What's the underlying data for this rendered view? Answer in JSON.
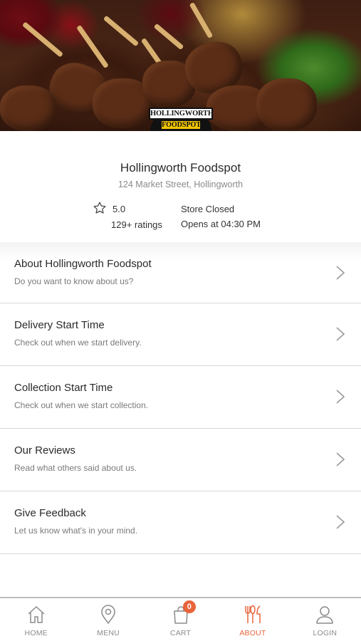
{
  "store": {
    "name": "Hollingworth Foodspot",
    "address": "124 Market Street, Hollingworth",
    "rating": "5.0",
    "rating_count": "129+ ratings",
    "status": "Store Closed",
    "open_time": "Opens at 04:30 PM",
    "logo_text_top": "HOLLINGWORTH",
    "logo_text_bottom": "FOODSPOT"
  },
  "about_items": [
    {
      "title": "About Hollingworth Foodspot",
      "description": "Do you want to know about us?"
    },
    {
      "title": "Delivery Start Time",
      "description": "Check out when we start delivery."
    },
    {
      "title": "Collection Start Time",
      "description": "Check out when we start collection."
    },
    {
      "title": "Our Reviews",
      "description": "Read what others said about us."
    },
    {
      "title": "Give Feedback",
      "description": "Let us know what's in your mind."
    }
  ],
  "tabs": [
    {
      "label": "HOME",
      "icon": "home-icon"
    },
    {
      "label": "MENU",
      "icon": "location-pin-icon"
    },
    {
      "label": "CART",
      "icon": "shopping-bag-icon",
      "badge": "0"
    },
    {
      "label": "ABOUT",
      "icon": "cutlery-icon",
      "active": true
    },
    {
      "label": "LOGIN",
      "icon": "user-icon"
    }
  ],
  "colors": {
    "accent": "#e8643a",
    "muted_text": "#8a8a8a",
    "divider": "#d8d8d8"
  }
}
